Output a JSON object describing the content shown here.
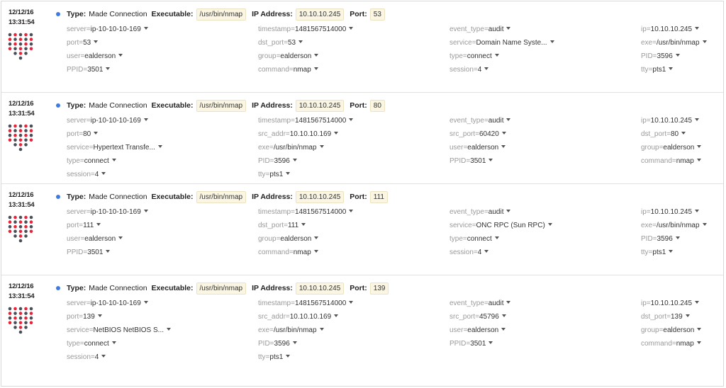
{
  "labels": {
    "type": "Type:",
    "executable": "Executable:",
    "ip_address": "IP Address:",
    "port": "Port:"
  },
  "colors": {
    "bullet": "#3d7be0",
    "dot_red": "#e8243b",
    "dot_gray": "#4a4f57"
  },
  "events": [
    {
      "date": "12/12/16",
      "time": "13:31:54",
      "type": "Made Connection",
      "executable": "/usr/bin/nmap",
      "ip": "10.10.10.245",
      "port": "53",
      "rows": [
        [
          {
            "k": "server",
            "v": "ip-10-10-10-169"
          },
          {
            "k": "timestamp",
            "v": "1481567514000"
          },
          {
            "k": "event_type",
            "v": "audit"
          },
          {
            "k": "ip",
            "v": "10.10.10.245"
          }
        ],
        [
          {
            "k": "port",
            "v": "53"
          },
          {
            "k": "dst_port",
            "v": "53"
          },
          {
            "k": "service",
            "v": "Domain Name Syste..."
          },
          {
            "k": "exe",
            "v": "/usr/bin/nmap"
          }
        ],
        [
          {
            "k": "user",
            "v": "ealderson"
          },
          {
            "k": "group",
            "v": "ealderson"
          },
          {
            "k": "type",
            "v": "connect"
          },
          {
            "k": "PID",
            "v": "3596"
          }
        ],
        [
          {
            "k": "PPID",
            "v": "3501"
          },
          {
            "k": "command",
            "v": "nmap"
          },
          {
            "k": "session",
            "v": "4"
          },
          {
            "k": "tty",
            "v": "pts1"
          }
        ]
      ]
    },
    {
      "date": "12/12/16",
      "time": "13:31:54",
      "type": "Made Connection",
      "executable": "/usr/bin/nmap",
      "ip": "10.10.10.245",
      "port": "80",
      "rows": [
        [
          {
            "k": "server",
            "v": "ip-10-10-10-169"
          },
          {
            "k": "timestamp",
            "v": "1481567514000"
          },
          {
            "k": "event_type",
            "v": "audit"
          },
          {
            "k": "ip",
            "v": "10.10.10.245"
          }
        ],
        [
          {
            "k": "port",
            "v": "80"
          },
          {
            "k": "src_addr",
            "v": "10.10.10.169"
          },
          {
            "k": "src_port",
            "v": "60420"
          },
          {
            "k": "dst_port",
            "v": "80"
          }
        ],
        [
          {
            "k": "service",
            "v": "Hypertext Transfe..."
          },
          {
            "k": "exe",
            "v": "/usr/bin/nmap"
          },
          {
            "k": "user",
            "v": "ealderson"
          },
          {
            "k": "group",
            "v": "ealderson"
          }
        ],
        [
          {
            "k": "type",
            "v": "connect"
          },
          {
            "k": "PID",
            "v": "3596"
          },
          {
            "k": "PPID",
            "v": "3501"
          },
          {
            "k": "command",
            "v": "nmap"
          }
        ],
        [
          {
            "k": "session",
            "v": "4"
          },
          {
            "k": "tty",
            "v": "pts1"
          }
        ]
      ]
    },
    {
      "date": "12/12/16",
      "time": "13:31:54",
      "type": "Made Connection",
      "executable": "/usr/bin/nmap",
      "ip": "10.10.10.245",
      "port": "111",
      "rows": [
        [
          {
            "k": "server",
            "v": "ip-10-10-10-169"
          },
          {
            "k": "timestamp",
            "v": "1481567514000"
          },
          {
            "k": "event_type",
            "v": "audit"
          },
          {
            "k": "ip",
            "v": "10.10.10.245"
          }
        ],
        [
          {
            "k": "port",
            "v": "111"
          },
          {
            "k": "dst_port",
            "v": "111"
          },
          {
            "k": "service",
            "v": "ONC RPC (Sun RPC)"
          },
          {
            "k": "exe",
            "v": "/usr/bin/nmap"
          }
        ],
        [
          {
            "k": "user",
            "v": "ealderson"
          },
          {
            "k": "group",
            "v": "ealderson"
          },
          {
            "k": "type",
            "v": "connect"
          },
          {
            "k": "PID",
            "v": "3596"
          }
        ],
        [
          {
            "k": "PPID",
            "v": "3501"
          },
          {
            "k": "command",
            "v": "nmap"
          },
          {
            "k": "session",
            "v": "4"
          },
          {
            "k": "tty",
            "v": "pts1"
          }
        ]
      ]
    },
    {
      "date": "12/12/16",
      "time": "13:31:54",
      "type": "Made Connection",
      "executable": "/usr/bin/nmap",
      "ip": "10.10.10.245",
      "port": "139",
      "rows": [
        [
          {
            "k": "server",
            "v": "ip-10-10-10-169"
          },
          {
            "k": "timestamp",
            "v": "1481567514000"
          },
          {
            "k": "event_type",
            "v": "audit"
          },
          {
            "k": "ip",
            "v": "10.10.10.245"
          }
        ],
        [
          {
            "k": "port",
            "v": "139"
          },
          {
            "k": "src_addr",
            "v": "10.10.10.169"
          },
          {
            "k": "src_port",
            "v": "45796"
          },
          {
            "k": "dst_port",
            "v": "139"
          }
        ],
        [
          {
            "k": "service",
            "v": "NetBIOS NetBIOS S..."
          },
          {
            "k": "exe",
            "v": "/usr/bin/nmap"
          },
          {
            "k": "user",
            "v": "ealderson"
          },
          {
            "k": "group",
            "v": "ealderson"
          }
        ],
        [
          {
            "k": "type",
            "v": "connect"
          },
          {
            "k": "PID",
            "v": "3596"
          },
          {
            "k": "PPID",
            "v": "3501"
          },
          {
            "k": "command",
            "v": "nmap"
          }
        ],
        [
          {
            "k": "session",
            "v": "4"
          },
          {
            "k": "tty",
            "v": "pts1"
          }
        ]
      ]
    }
  ]
}
